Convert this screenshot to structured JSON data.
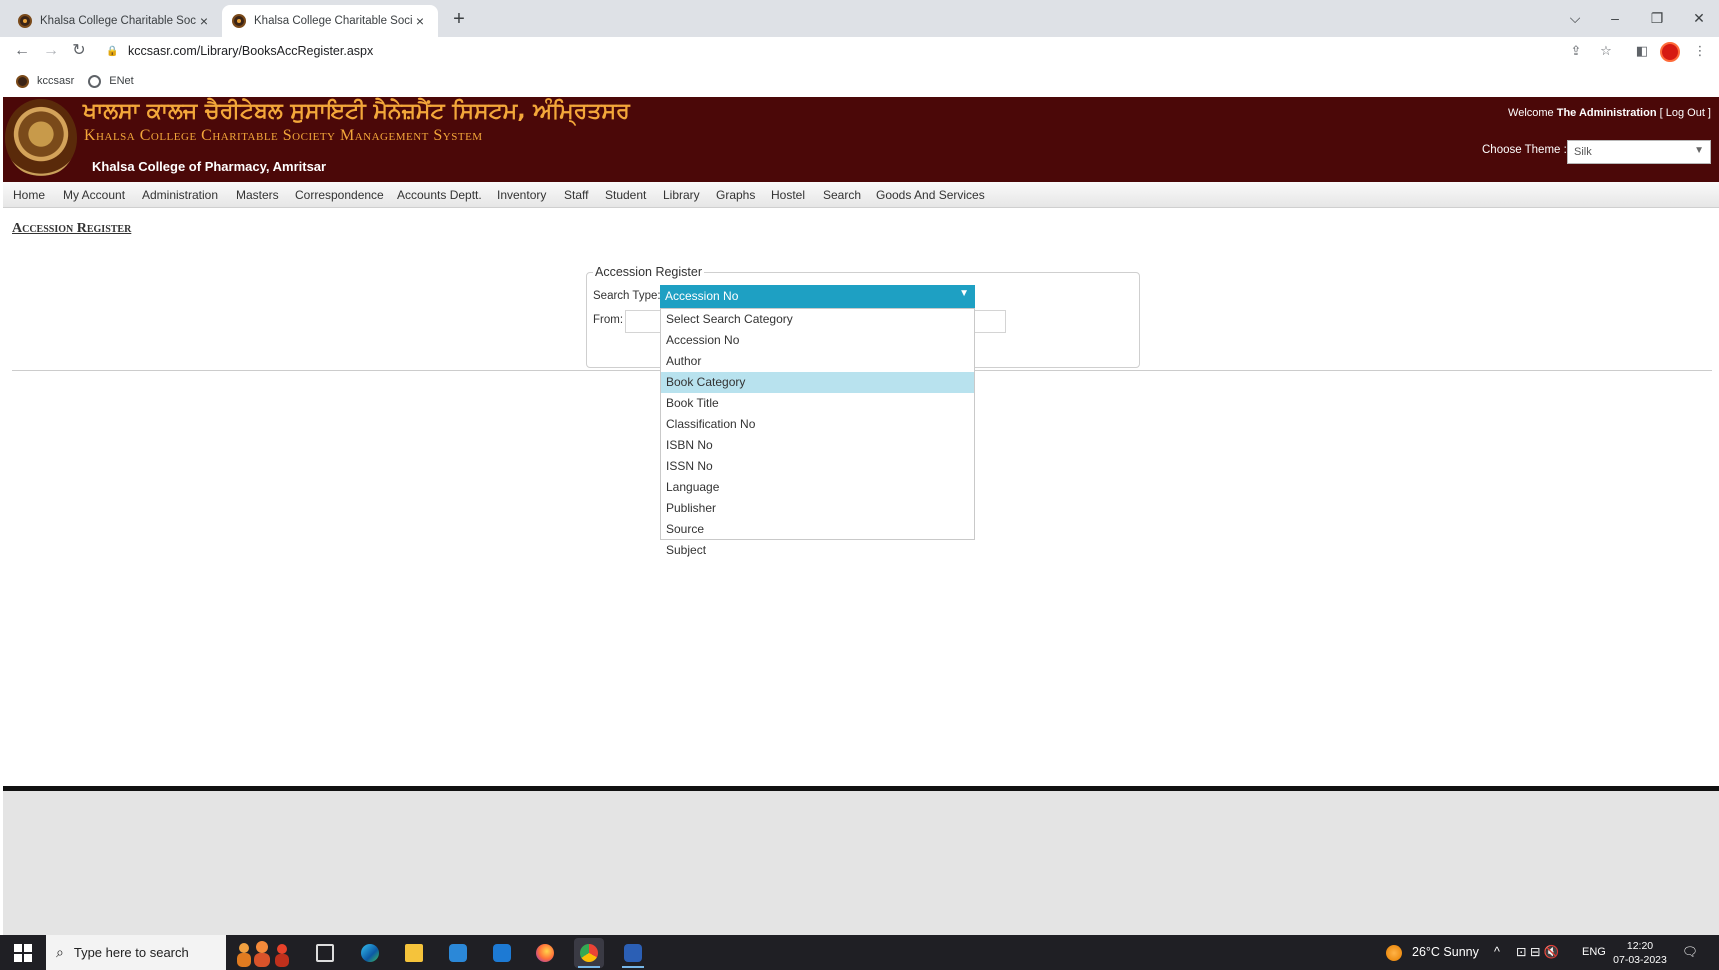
{
  "browser": {
    "tabs": [
      {
        "title": "Khalsa College Charitable Society",
        "close": "×"
      },
      {
        "title": "Khalsa College Charitable Society",
        "close": "×"
      }
    ],
    "new_tab": "+",
    "window": {
      "chevron": "⌵",
      "minimize": "–",
      "restore": "❐",
      "close": "✕"
    },
    "nav": {
      "back": "←",
      "forward": "→",
      "reload": "↻"
    },
    "url": "kccsasr.com/Library/BooksAccRegister.aspx",
    "bookmarks": [
      "kccsasr",
      "ENet"
    ]
  },
  "header": {
    "gurmukhi_title": "ਖਾਲਸਾ ਕਾਲਜ ਚੈਰੀਟੇਬਲ ਸੁਸਾਇਟੀ ਮੈਨੇਜ਼ਮੈਂਟ ਸਿਸਟਮ, ਅੰਮ੍ਰਿਤਸਰ",
    "english_title": "Khalsa College Charitable Society Management System",
    "college": "Khalsa College of Pharmacy, Amritsar",
    "welcome_prefix": "Welcome",
    "user": "The Administration",
    "logout": "[ Log Out ]",
    "theme_label": "Choose Theme :",
    "theme_value": "Silk"
  },
  "menu": [
    "Home",
    "My Account",
    "Administration",
    "Masters",
    "Correspondence",
    "Accounts Deptt.",
    "Inventory",
    "Staff",
    "Student",
    "Library",
    "Graphs",
    "Hostel",
    "Search",
    "Goods And Services"
  ],
  "page": {
    "heading": "Accession Register",
    "fieldset_legend": "Accession Register",
    "search_type_label": "Search Type:",
    "from_label": "From:",
    "selected_search_type": "Accession No",
    "options": [
      "Select Search Category",
      "Accession No",
      "Author",
      "Book Category",
      "Book Title",
      "Classification No",
      "ISBN No",
      "ISSN No",
      "Language",
      "Publisher",
      "Source",
      "Subject"
    ],
    "highlighted_option": "Book Category"
  },
  "taskbar": {
    "search_placeholder": "Type here to search",
    "weather": "26°C  Sunny",
    "lang": "ENG",
    "time": "12:20",
    "date": "07-03-2023"
  },
  "colors": {
    "header_bg": "#4b0808",
    "header_gold": "#f3a73a",
    "select_blue": "#1ea0c3",
    "highlight": "#b8e2ee"
  }
}
